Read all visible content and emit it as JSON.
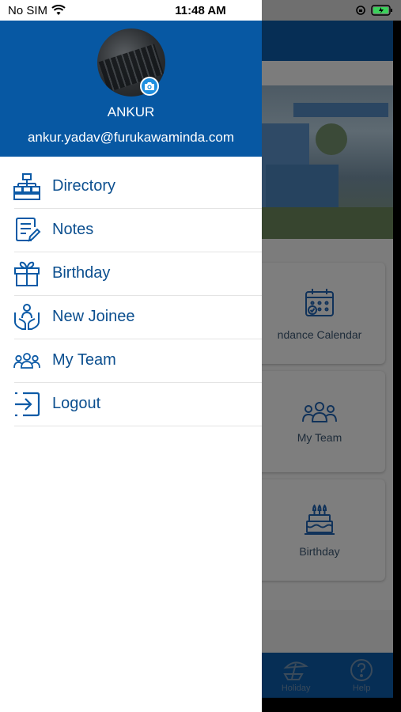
{
  "status_bar": {
    "carrier": "No SIM",
    "time": "11:48 AM"
  },
  "profile": {
    "name": "ANKUR",
    "email": "ankur.yadav@furukawaminda.com"
  },
  "menu": {
    "items": [
      {
        "label": "Directory",
        "icon": "org-chart-icon"
      },
      {
        "label": "Notes",
        "icon": "notes-icon"
      },
      {
        "label": "Birthday",
        "icon": "gift-icon"
      },
      {
        "label": "New Joinee",
        "icon": "hands-person-icon"
      },
      {
        "label": "My Team",
        "icon": "team-icon"
      },
      {
        "label": "Logout",
        "icon": "logout-icon"
      }
    ]
  },
  "background": {
    "cards": [
      {
        "label": "ndance Calendar",
        "icon": "calendar-icon"
      },
      {
        "label": "My Team",
        "icon": "team-icon"
      },
      {
        "label": "Birthday",
        "icon": "cake-icon"
      }
    ],
    "tabs": [
      {
        "label": "Holiday",
        "icon": "beach-icon"
      },
      {
        "label": "Help",
        "icon": "question-icon"
      }
    ]
  },
  "colors": {
    "drawer_header": "#0758a3",
    "menu_text": "#0c4f8f",
    "accent": "#1e8fe0"
  }
}
